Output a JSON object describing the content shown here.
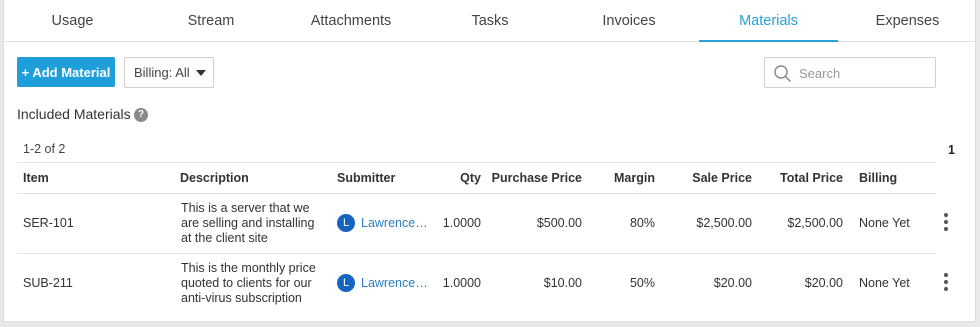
{
  "tabs": [
    {
      "label": "Usage"
    },
    {
      "label": "Stream"
    },
    {
      "label": "Attachments"
    },
    {
      "label": "Tasks"
    },
    {
      "label": "Invoices"
    },
    {
      "label": "Materials"
    },
    {
      "label": "Expenses"
    }
  ],
  "active_tab": "Materials",
  "toolbar": {
    "add_label": "+ Add Material",
    "billing_filter": "Billing: All",
    "search_placeholder": "Search"
  },
  "section": {
    "title": "Included Materials",
    "help": "?",
    "count": "1-2 of 2",
    "page": "1"
  },
  "table": {
    "columns": [
      "Item",
      "Description",
      "Submitter",
      "Qty",
      "Purchase Price",
      "Margin",
      "Sale Price",
      "Total Price",
      "Billing"
    ],
    "rows": [
      {
        "item": "SER-101",
        "desc": [
          "This is a server that we",
          "are selling and installing",
          "at the client site"
        ],
        "avatar": "L",
        "submitter": "Lawrence…",
        "qty": "1.0000",
        "purchase": "$500.00",
        "margin": "80%",
        "sale": "$2,500.00",
        "total": "$2,500.00",
        "billing": "None Yet"
      },
      {
        "item": "SUB-211",
        "desc": [
          "This is the monthly price",
          "quoted to clients for our",
          "anti-virus subscription"
        ],
        "avatar": "L",
        "submitter": "Lawrence…",
        "qty": "1.0000",
        "purchase": "$10.00",
        "margin": "50%",
        "sale": "$20.00",
        "total": "$20.00",
        "billing": "None Yet"
      }
    ]
  },
  "colors": {
    "accent": "#2a9fd8",
    "button": "#1e9fd9",
    "avatar": "#1565c0",
    "link": "#2a7fc4"
  },
  "icons": {
    "search": "search-icon",
    "help": "help-icon",
    "row_menu": "kebab-menu-icon",
    "dropdown": "caret-down-icon"
  }
}
